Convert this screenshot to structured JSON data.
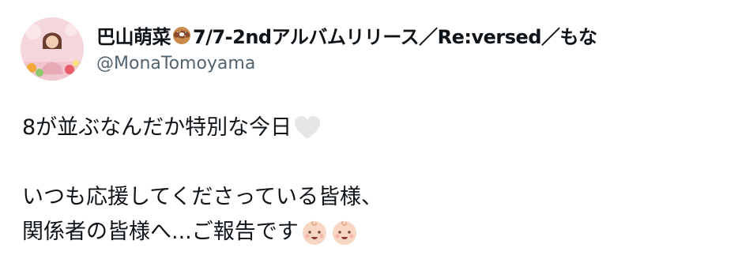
{
  "tweet": {
    "author": {
      "name_prefix": "巴山萌菜",
      "name_suffix": "7/7-2ndアルバムリリース／Re:versed／もな",
      "name_icon": "donut-icon",
      "handle": "@MonaTomoyama"
    },
    "text": {
      "line1": "8が並ぶなんだか特別な今日",
      "line1_icon": "white-heart-icon",
      "line2": "いつも応援してくださっている皆様、",
      "line3": "関係者の皆様へ...ご報告です",
      "line3_icons": [
        "baby-face-icon",
        "baby-face-icon"
      ]
    }
  },
  "colors": {
    "text_primary": "#0f1419",
    "text_secondary": "#536471",
    "heart": "#e6e6e6",
    "baby_skin": "#f7d7c4"
  }
}
